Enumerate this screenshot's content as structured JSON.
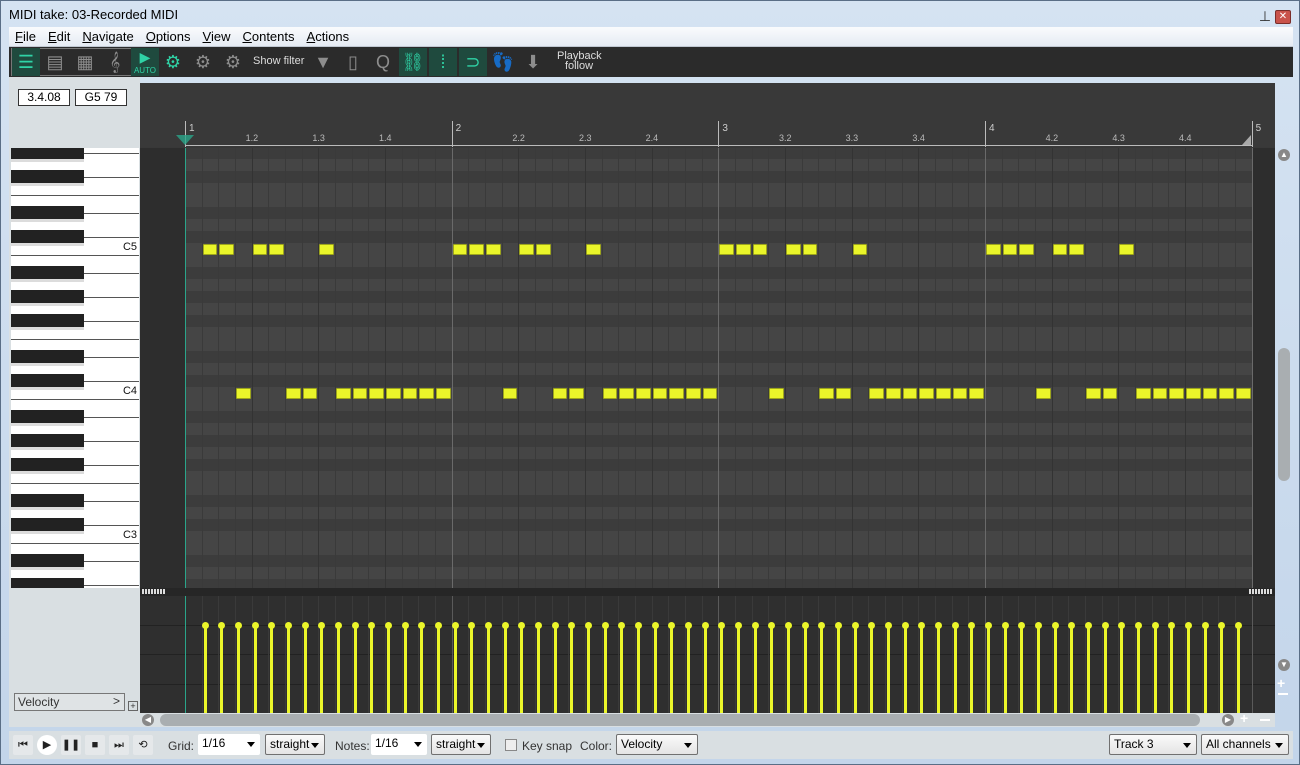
{
  "window": {
    "title": "MIDI take: 03-Recorded MIDI",
    "pin_icon": "pin-icon",
    "close_icon": "close-icon"
  },
  "menu": [
    {
      "label": "File",
      "accel": "F"
    },
    {
      "label": "Edit",
      "accel": "E"
    },
    {
      "label": "Navigate",
      "accel": "N"
    },
    {
      "label": "Options",
      "accel": "O"
    },
    {
      "label": "View",
      "accel": "V"
    },
    {
      "label": "Contents",
      "accel": "C"
    },
    {
      "label": "Actions",
      "accel": "A"
    }
  ],
  "toolbar": {
    "auto_label": "AUTO",
    "show_filter": "Show filter",
    "playback_follow_1": "Playback",
    "playback_follow_2": "follow"
  },
  "position_display": "3.4.08",
  "note_display": "G5  79",
  "ruler": {
    "bars": [
      "1",
      "2",
      "3",
      "4",
      "5"
    ],
    "beats": [
      "1.2",
      "1.3",
      "1.4",
      "2.2",
      "2.3",
      "2.4",
      "3.2",
      "3.3",
      "3.4",
      "4.2",
      "4.3",
      "4.4"
    ]
  },
  "piano": {
    "labels": [
      "C5",
      "C4",
      "C3"
    ]
  },
  "notes": {
    "grid": "1/16",
    "pitch_high": "C5",
    "pitch_low": "C4",
    "pattern_high_first_bar": [
      1,
      2,
      4,
      5,
      8
    ],
    "pattern_high": [
      0,
      1,
      2,
      4,
      5,
      8
    ],
    "pattern_low": [
      3,
      6,
      7,
      9,
      10,
      11,
      12,
      13,
      14,
      15
    ],
    "bars": 4,
    "velocity": 96
  },
  "lane": {
    "label": "Velocity",
    "add_icon": "plus-icon"
  },
  "bottom": {
    "grid_label": "Grid:",
    "grid_value": "1/16",
    "grid_type": "straight",
    "notes_label": "Notes:",
    "notes_value": "1/16",
    "notes_type": "straight",
    "keysnap_label": "Key snap",
    "keysnap_checked": false,
    "color_label": "Color:",
    "color_value": "Velocity",
    "track_value": "Track 3",
    "channel_value": "All channels"
  },
  "colors": {
    "note": "#eaf52a",
    "accent": "#2fd3a6",
    "background": "#2d2d2d"
  }
}
